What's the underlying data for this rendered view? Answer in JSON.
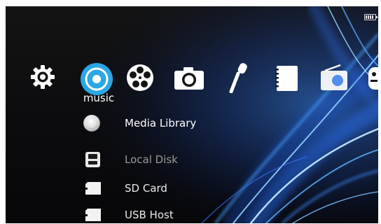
{
  "status": {
    "battery_icon": "battery-icon"
  },
  "top_menu": {
    "items": [
      {
        "name": "settings",
        "icon": "gear-icon"
      },
      {
        "name": "music",
        "icon": "music-disc-icon",
        "selected": true
      },
      {
        "name": "video",
        "icon": "film-reel-icon"
      },
      {
        "name": "photo",
        "icon": "camera-icon"
      },
      {
        "name": "recorder",
        "icon": "microphone-icon"
      },
      {
        "name": "ebook",
        "icon": "notebook-icon"
      },
      {
        "name": "radio",
        "icon": "radio-icon"
      },
      {
        "name": "games",
        "icon": "gamepad-icon"
      }
    ],
    "selected_label": "music"
  },
  "sub_menu": {
    "items": [
      {
        "label": "Media Library",
        "icon": "disc-icon",
        "state": "active"
      },
      {
        "label": "Local Disk",
        "icon": "disk-icon",
        "state": "dim"
      },
      {
        "label": "SD Card",
        "icon": "sd-card-icon",
        "state": "normal"
      },
      {
        "label": "USB Host",
        "icon": "usb-icon",
        "state": "normal"
      }
    ]
  },
  "colors": {
    "accent": "#29a8e6",
    "background": "#0d0d0f",
    "swirl": "#2f7be8"
  }
}
